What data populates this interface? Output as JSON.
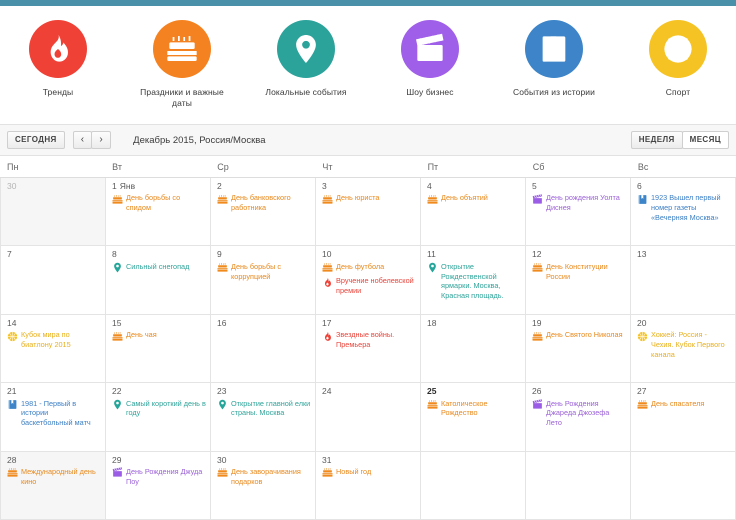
{
  "theme": {
    "topbar_color": "#4a90a8",
    "holiday_color": "#f08a1d",
    "local_color": "#26a69a",
    "show_color": "#9b5de5",
    "history_color": "#3d85c8",
    "sport_color": "#f6c324",
    "trend_color": "#ef4136"
  },
  "categories": [
    {
      "label": "Тренды",
      "icon": "flame-icon",
      "color": "#ef4136"
    },
    {
      "label": "Праздники и важные даты",
      "icon": "cake-icon",
      "color": "#f58220"
    },
    {
      "label": "Локальные события",
      "icon": "map-pin-icon",
      "color": "#2ba39b"
    },
    {
      "label": "Шоу бизнес",
      "icon": "clapperboard-icon",
      "color": "#a05fe8"
    },
    {
      "label": "События из истории",
      "icon": "book-icon",
      "color": "#3d85c8"
    },
    {
      "label": "Спорт",
      "icon": "basketball-icon",
      "color": "#f6c324"
    }
  ],
  "toolbar": {
    "today_label": "СЕГОДНЯ",
    "prev_label": "‹",
    "next_label": "›",
    "period_title": "Декабрь 2015, Россия/Москва",
    "week_label": "НЕДЕЛЯ",
    "month_label": "МЕСЯЦ",
    "active_view": "month"
  },
  "weekdays": [
    "Пн",
    "Вт",
    "Ср",
    "Чт",
    "Пт",
    "Сб",
    "Вс"
  ],
  "weeks": [
    [
      {
        "day": "30",
        "month_suffix": "",
        "out": true,
        "today": false,
        "events": []
      },
      {
        "day": "1",
        "month_suffix": "Янв",
        "out": false,
        "today": false,
        "events": [
          {
            "icon": "cake-icon",
            "cat": "holiday",
            "text": "День борьбы со спидом"
          }
        ]
      },
      {
        "day": "2",
        "month_suffix": "",
        "out": false,
        "today": false,
        "events": [
          {
            "icon": "cake-icon",
            "cat": "holiday",
            "text": "День банковского работника"
          }
        ]
      },
      {
        "day": "3",
        "month_suffix": "",
        "out": false,
        "today": false,
        "events": [
          {
            "icon": "cake-icon",
            "cat": "holiday",
            "text": "День юриста"
          }
        ]
      },
      {
        "day": "4",
        "month_suffix": "",
        "out": false,
        "today": false,
        "events": [
          {
            "icon": "cake-icon",
            "cat": "holiday",
            "text": "День объятий"
          }
        ]
      },
      {
        "day": "5",
        "month_suffix": "",
        "out": false,
        "today": false,
        "events": [
          {
            "icon": "clapperboard-icon",
            "cat": "show",
            "text": "День рождения Уолта Диснея"
          }
        ]
      },
      {
        "day": "6",
        "month_suffix": "",
        "out": false,
        "today": false,
        "events": [
          {
            "icon": "book-icon",
            "cat": "history",
            "text": "1923   Вышел первый номер газеты «Вечерняя Москва»"
          }
        ]
      }
    ],
    [
      {
        "day": "7",
        "month_suffix": "",
        "out": false,
        "today": false,
        "events": []
      },
      {
        "day": "8",
        "month_suffix": "",
        "out": false,
        "today": false,
        "events": [
          {
            "icon": "map-pin-icon",
            "cat": "local",
            "text": "Сильный снегопад"
          }
        ]
      },
      {
        "day": "9",
        "month_suffix": "",
        "out": false,
        "today": false,
        "events": [
          {
            "icon": "cake-icon",
            "cat": "holiday",
            "text": "День борьбы с коррупцией"
          }
        ]
      },
      {
        "day": "10",
        "month_suffix": "",
        "out": false,
        "today": false,
        "events": [
          {
            "icon": "cake-icon",
            "cat": "holiday",
            "text": "День футбола"
          },
          {
            "icon": "flame-icon",
            "cat": "trend",
            "text": "Вручение нобелевской премии"
          }
        ]
      },
      {
        "day": "11",
        "month_suffix": "",
        "out": false,
        "today": false,
        "events": [
          {
            "icon": "map-pin-icon",
            "cat": "local",
            "text": "Открытие Рождественской ярмарки. Москва, Красная площадь."
          }
        ]
      },
      {
        "day": "12",
        "month_suffix": "",
        "out": false,
        "today": false,
        "events": [
          {
            "icon": "cake-icon",
            "cat": "holiday",
            "text": "День Конституции России"
          }
        ]
      },
      {
        "day": "13",
        "month_suffix": "",
        "out": false,
        "today": false,
        "events": []
      }
    ],
    [
      {
        "day": "14",
        "month_suffix": "",
        "out": false,
        "today": false,
        "events": [
          {
            "icon": "basketball-icon",
            "cat": "sport",
            "text": "Кубок мира по биатлону 2015"
          }
        ]
      },
      {
        "day": "15",
        "month_suffix": "",
        "out": false,
        "today": false,
        "events": [
          {
            "icon": "cake-icon",
            "cat": "holiday",
            "text": "День чая"
          }
        ]
      },
      {
        "day": "16",
        "month_suffix": "",
        "out": false,
        "today": false,
        "events": []
      },
      {
        "day": "17",
        "month_suffix": "",
        "out": false,
        "today": false,
        "events": [
          {
            "icon": "flame-icon",
            "cat": "trend",
            "text": "Звездные войны. Премьера"
          }
        ]
      },
      {
        "day": "18",
        "month_suffix": "",
        "out": false,
        "today": false,
        "events": []
      },
      {
        "day": "19",
        "month_suffix": "",
        "out": false,
        "today": false,
        "events": [
          {
            "icon": "cake-icon",
            "cat": "holiday",
            "text": "День Святого Николая"
          }
        ]
      },
      {
        "day": "20",
        "month_suffix": "",
        "out": false,
        "today": false,
        "events": [
          {
            "icon": "basketball-icon",
            "cat": "sport",
            "text": "Хоккей: Россия - Чехия. Кубок Первого канала"
          }
        ]
      }
    ],
    [
      {
        "day": "21",
        "month_suffix": "",
        "out": false,
        "today": false,
        "events": [
          {
            "icon": "book-icon",
            "cat": "history",
            "text": "1981 - Первый в истории баскетбольный матч"
          }
        ]
      },
      {
        "day": "22",
        "month_suffix": "",
        "out": false,
        "today": false,
        "events": [
          {
            "icon": "map-pin-icon",
            "cat": "local",
            "text": "Самый короткий день в году"
          }
        ]
      },
      {
        "day": "23",
        "month_suffix": "",
        "out": false,
        "today": false,
        "events": [
          {
            "icon": "map-pin-icon",
            "cat": "local",
            "text": "Открытие главной елки страны. Москва"
          }
        ]
      },
      {
        "day": "24",
        "month_suffix": "",
        "out": false,
        "today": false,
        "events": []
      },
      {
        "day": "25",
        "month_suffix": "",
        "out": false,
        "today": true,
        "events": [
          {
            "icon": "cake-icon",
            "cat": "holiday",
            "text": "Католическое Рождество"
          }
        ]
      },
      {
        "day": "26",
        "month_suffix": "",
        "out": false,
        "today": false,
        "events": [
          {
            "icon": "clapperboard-icon",
            "cat": "show",
            "text": "День Рождения Джареда Джозефа Лето"
          }
        ]
      },
      {
        "day": "27",
        "month_suffix": "",
        "out": false,
        "today": false,
        "events": [
          {
            "icon": "cake-icon",
            "cat": "holiday",
            "text": "День спасателя"
          }
        ]
      }
    ],
    [
      {
        "day": "28",
        "month_suffix": "",
        "out": false,
        "today": false,
        "shaded": true,
        "events": [
          {
            "icon": "cake-icon",
            "cat": "holiday",
            "text": "Международный день кино"
          }
        ]
      },
      {
        "day": "29",
        "month_suffix": "",
        "out": false,
        "today": false,
        "events": [
          {
            "icon": "clapperboard-icon",
            "cat": "show",
            "text": "День Рождения Джуда Поу"
          }
        ]
      },
      {
        "day": "30",
        "month_suffix": "",
        "out": false,
        "today": false,
        "events": [
          {
            "icon": "cake-icon",
            "cat": "holiday",
            "text": "День заворачивания подарков"
          }
        ]
      },
      {
        "day": "31",
        "month_suffix": "",
        "out": false,
        "today": false,
        "events": [
          {
            "icon": "cake-icon",
            "cat": "holiday",
            "text": "Новый год"
          }
        ]
      },
      {
        "day": "",
        "month_suffix": "",
        "out": false,
        "today": false,
        "events": []
      },
      {
        "day": "",
        "month_suffix": "",
        "out": false,
        "today": false,
        "events": []
      },
      {
        "day": "",
        "month_suffix": "",
        "out": false,
        "today": false,
        "events": []
      }
    ]
  ]
}
